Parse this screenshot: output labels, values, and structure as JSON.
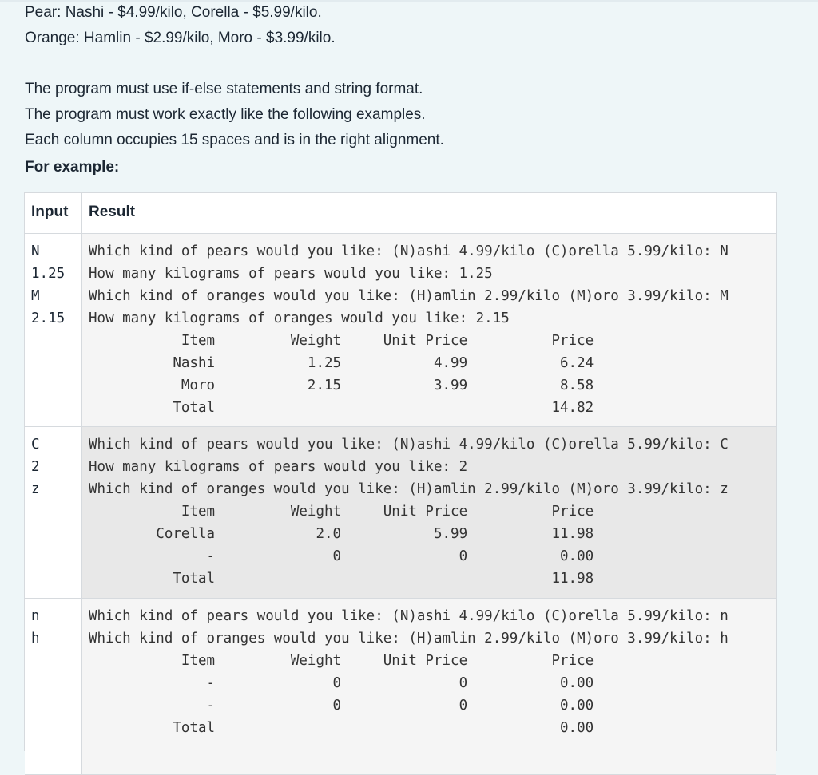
{
  "intro": {
    "line1": "Pear: Nashi - $4.99/kilo, Corella - $5.99/kilo.",
    "line2": "Orange: Hamlin - $2.99/kilo, Moro - $3.99/kilo.",
    "line3": "The program must use if-else statements and string format.",
    "line4": "The program must work exactly like the following examples.",
    "line5": "Each column occupies 15 spaces and is in the right alignment.",
    "for_example": "For example:"
  },
  "table": {
    "headers": {
      "input": "Input",
      "result": "Result"
    },
    "rows": [
      {
        "input": "N\n1.25\nM\n2.15",
        "result": "Which kind of pears would you like: (N)ashi 4.99/kilo (C)orella 5.99/kilo: N\nHow many kilograms of pears would you like: 1.25\nWhich kind of oranges would you like: (H)amlin 2.99/kilo (M)oro 3.99/kilo: M\nHow many kilograms of oranges would you like: 2.15\n           Item         Weight     Unit Price          Price\n          Nashi           1.25           4.99           6.24\n           Moro           2.15           3.99           8.58\n          Total                                        14.82"
      },
      {
        "input": "C\n2\nz",
        "result": "Which kind of pears would you like: (N)ashi 4.99/kilo (C)orella 5.99/kilo: C\nHow many kilograms of pears would you like: 2\nWhich kind of oranges would you like: (H)amlin 2.99/kilo (M)oro 3.99/kilo: z\n           Item         Weight     Unit Price          Price\n        Corella            2.0           5.99          11.98\n              -              0              0           0.00\n          Total                                        11.98"
      },
      {
        "input": "n\nh",
        "result": "Which kind of pears would you like: (N)ashi 4.99/kilo (C)orella 5.99/kilo: n\nWhich kind of oranges would you like: (H)amlin 2.99/kilo (M)oro 3.99/kilo: h\n           Item         Weight     Unit Price          Price\n              -              0              0           0.00\n              -              0              0           0.00\n          Total                                         0.00"
      }
    ]
  }
}
